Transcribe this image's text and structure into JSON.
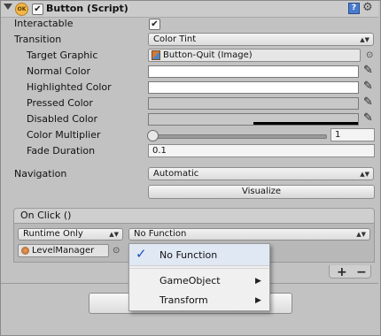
{
  "header": {
    "title": "Button (Script)",
    "ok_icon_text": "OK",
    "enabled_mark": "✔",
    "help_glyph": "?",
    "gear_glyph": "⚙"
  },
  "fields": {
    "interactable_label": "Interactable",
    "interactable_mark": "✔",
    "transition_label": "Transition",
    "transition_value": "Color Tint",
    "target_graphic_label": "Target Graphic",
    "target_graphic_value": "Button-Quit (Image)",
    "normal_color_label": "Normal Color",
    "highlighted_color_label": "Highlighted Color",
    "pressed_color_label": "Pressed Color",
    "disabled_color_label": "Disabled Color",
    "color_multiplier_label": "Color Multiplier",
    "color_multiplier_value": "1",
    "fade_duration_label": "Fade Duration",
    "fade_duration_value": "0.1",
    "navigation_label": "Navigation",
    "navigation_value": "Automatic",
    "visualize_label": "Visualize"
  },
  "colors": {
    "normal": "#ffffff",
    "highlighted": "#ffffff",
    "pressed": "#c8c8c8",
    "disabled": "#c8c8c8",
    "alpha_bar": "#000000"
  },
  "slider": {
    "color_multiplier_level": 1
  },
  "on_click": {
    "header": "On Click ()",
    "runtime_value": "Runtime Only",
    "function_value": "No Function",
    "object_value": "LevelManager",
    "plus": "+",
    "minus": "−"
  },
  "menu": {
    "check_glyph": "✓",
    "items": [
      {
        "label": "No Function",
        "selected": true
      },
      {
        "label": "GameObject",
        "submenu": true
      },
      {
        "label": "Transform",
        "submenu": true
      }
    ],
    "submenu_glyph": "▶"
  },
  "glyphs": {
    "popup_arrows": "▲▼",
    "target": "⊙",
    "eyedropper": "✎"
  }
}
